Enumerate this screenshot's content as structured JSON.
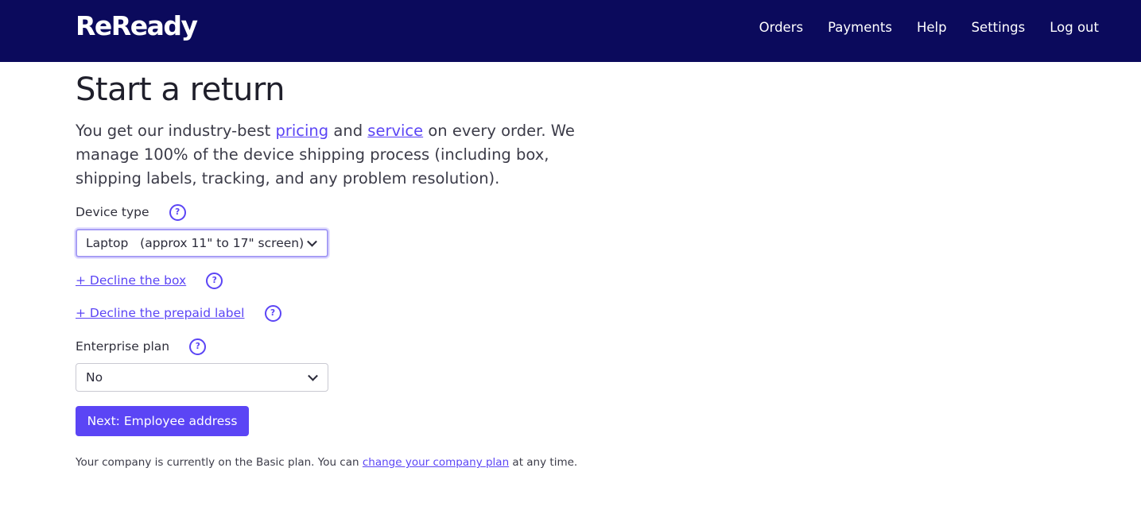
{
  "header": {
    "logo": "ReReady",
    "nav": [
      "Orders",
      "Payments",
      "Help",
      "Settings",
      "Log out"
    ]
  },
  "page": {
    "title": "Start a return",
    "intro_before": "You get our industry-best ",
    "intro_link1": "pricing",
    "intro_middle": " and ",
    "intro_link2": "service",
    "intro_after": " on every order. We manage 100% of the device shipping process (including box, shipping labels, tracking, and any problem resolution)."
  },
  "form": {
    "device_type_label": "Device type",
    "device_type_value": "Laptop   (approx 11\" to 17\" screen)",
    "decline_box": "+ Decline the box",
    "decline_label": "+ Decline the prepaid label",
    "enterprise_label": "Enterprise plan",
    "enterprise_value": "No",
    "help_glyph": "?",
    "next_button": "Next: Employee address"
  },
  "footnote": {
    "before": "Your company is currently on the Basic plan. You can ",
    "link": "change your company plan",
    "after": " at any time."
  },
  "colors": {
    "header_bg": "#0b0a5c",
    "accent": "#5b45f5"
  }
}
